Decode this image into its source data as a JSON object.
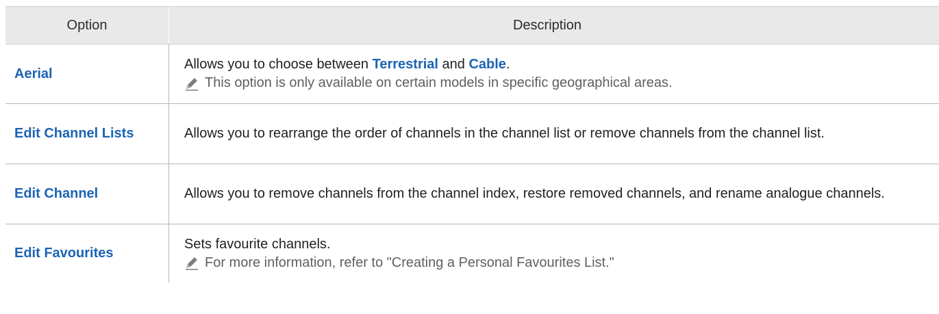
{
  "header": {
    "option": "Option",
    "description": "Description"
  },
  "rows": [
    {
      "option": "Aerial",
      "desc_prefix": "Allows you to choose between ",
      "link1": "Terrestrial",
      "desc_mid": " and ",
      "link2": "Cable",
      "desc_suffix": ".",
      "note": "This option is only available on certain models in specific geographical areas."
    },
    {
      "option": "Edit Channel Lists",
      "desc": "Allows you to rearrange the order of channels in the channel list or remove channels from the channel list."
    },
    {
      "option": "Edit Channel",
      "desc": "Allows you to remove channels from the channel index, restore removed channels, and rename analogue channels."
    },
    {
      "option": "Edit Favourites",
      "desc": "Sets favourite channels.",
      "note": "For more information, refer to \"Creating a Personal Favourites List.\""
    }
  ],
  "icons": {
    "note_icon": "pencil-icon"
  },
  "colors": {
    "link": "#1b63b4",
    "header_bg": "#e9e9e9",
    "note_text": "#5f5f5f"
  }
}
